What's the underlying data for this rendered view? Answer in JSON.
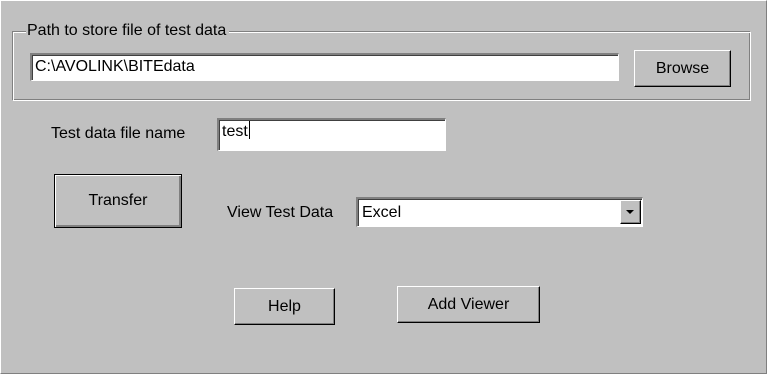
{
  "path_group": {
    "legend": "Path to store file of test data",
    "path_value": "C:\\AVOLINK\\BITEdata",
    "browse_label": "Browse"
  },
  "file_name": {
    "label": "Test data file name",
    "value": "test"
  },
  "transfer_label": "Transfer",
  "view_test_data": {
    "label": "View Test Data",
    "selected": "Excel",
    "arrow_icon": "chevron-down-icon"
  },
  "help_label": "Help",
  "add_viewer_label": "Add Viewer",
  "colors": {
    "face": "#c0c0c0",
    "field": "#ffffff",
    "shadow": "#808080",
    "highlight": "#ffffff"
  }
}
